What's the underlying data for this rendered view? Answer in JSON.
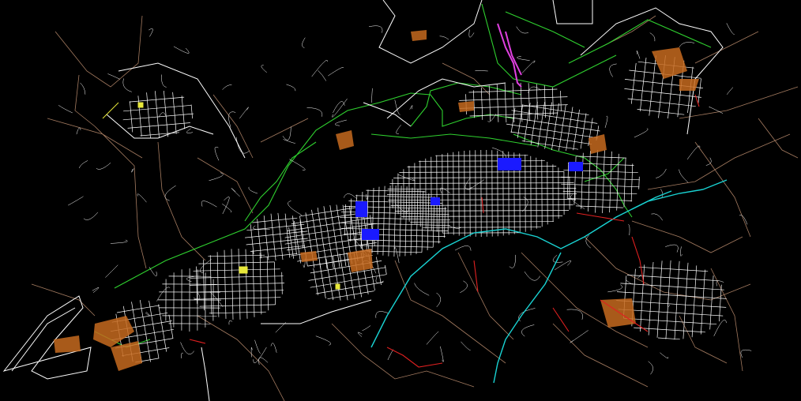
{
  "map": {
    "background_color": "#000000",
    "layer_colors": {
      "streets": "#ffffff",
      "rural_roads": "#b88a6c",
      "boundaries": "#2fd12f",
      "river": "#19d3d3",
      "zones": "#c66a1f",
      "blocks_blue": "#1a1aff",
      "highlight_magenta": "#e040e0",
      "red_lines": "#e02020",
      "yellow_marks": "#e8e83a"
    }
  }
}
